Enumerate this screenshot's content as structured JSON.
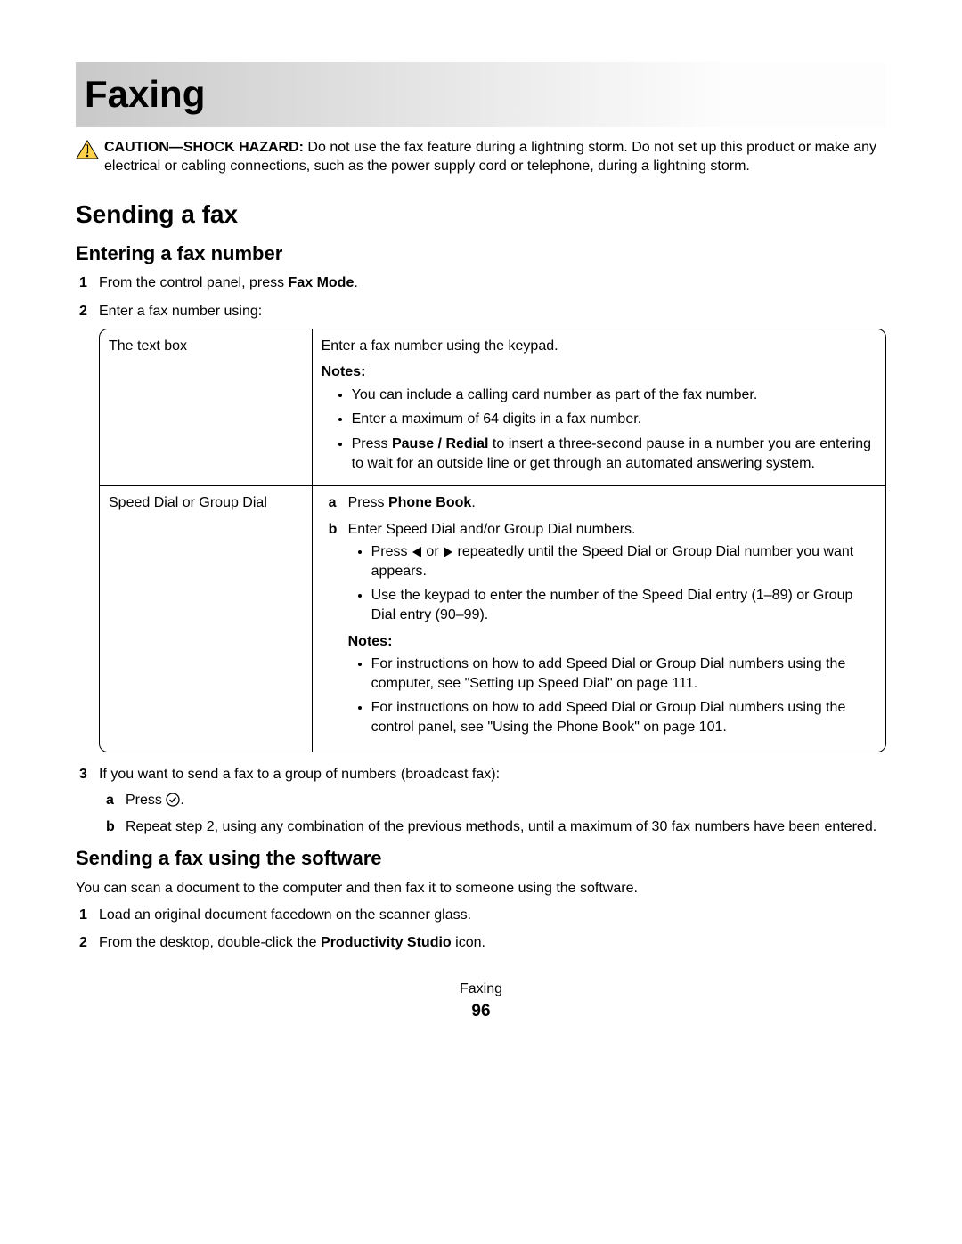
{
  "chapter_title": "Faxing",
  "caution": {
    "label": "CAUTION—SHOCK HAZARD:",
    "text": " Do not use the fax feature during a lightning storm. Do not set up this product or make any electrical or cabling connections, such as the power supply cord or telephone, during a lightning storm."
  },
  "section_sending": "Sending a fax",
  "subsection_entering": "Entering a fax number",
  "step1_pre": "From the control panel, press ",
  "step1_bold": "Fax Mode",
  "step1_post": ".",
  "step2": "Enter a fax number using:",
  "table": {
    "row1_label": "The text box",
    "row1_intro": "Enter a fax number using the keypad.",
    "notes_label": "Notes:",
    "row1_b1": "You can include a calling card number as part of the fax number.",
    "row1_b2": "Enter a maximum of 64 digits in a fax number.",
    "row1_b3_pre": "Press ",
    "row1_b3_bold": "Pause / Redial",
    "row1_b3_post": " to insert a three-second pause in a number you are entering to wait for an outside line or get through an automated answering system.",
    "row2_label": "Speed Dial or Group Dial",
    "row2_a_pre": "Press ",
    "row2_a_bold": "Phone Book",
    "row2_a_post": ".",
    "row2_b": "Enter Speed Dial and/or Group Dial numbers.",
    "row2_sub1_pre": "Press ",
    "row2_sub1_mid": " or ",
    "row2_sub1_post": " repeatedly until the Speed Dial or Group Dial number you want appears.",
    "row2_sub2": "Use the keypad to enter the number of the Speed Dial entry (1–89) or Group Dial entry (90–99).",
    "row2_note1": "For instructions on how to add Speed Dial or Group Dial numbers using the computer, see \"Setting up Speed Dial\" on page 111.",
    "row2_note2": "For instructions on how to add Speed Dial or Group Dial numbers using the control panel, see \"Using the Phone Book\" on page 101."
  },
  "step3_intro": "If you want to send a fax to a group of numbers (broadcast fax):",
  "step3_a_pre": "Press ",
  "step3_a_post": ".",
  "step3_b": "Repeat step 2, using any combination of the previous methods, until a maximum of 30 fax numbers have been entered.",
  "subsection_software": "Sending a fax using the software",
  "software_intro": "You can scan a document to the computer and then fax it to someone using the software.",
  "sw_step1": "Load an original document facedown on the scanner glass.",
  "sw_step2_pre": "From the desktop, double-click the ",
  "sw_step2_bold": "Productivity Studio",
  "sw_step2_post": " icon.",
  "footer_label": "Faxing",
  "footer_page": "96"
}
